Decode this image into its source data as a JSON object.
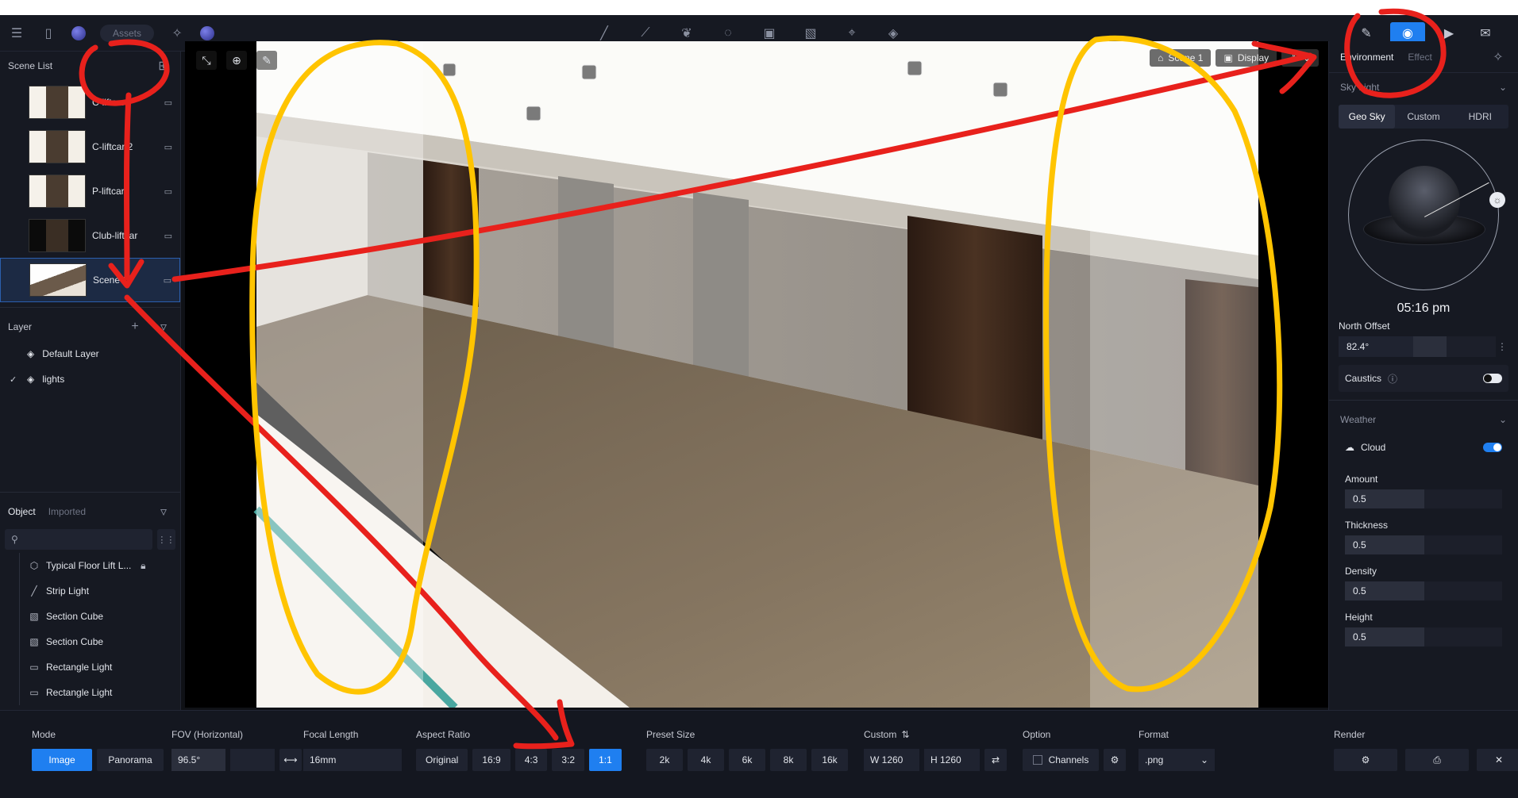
{
  "toolbar": {
    "assets_placeholder": "Assets"
  },
  "scene_list": {
    "title": "Scene List",
    "items": [
      {
        "label": "C-liftcar"
      },
      {
        "label": "C-liftcar 2"
      },
      {
        "label": "P-liftcar"
      },
      {
        "label": "Club-liftcar"
      },
      {
        "label": "Scene 1"
      }
    ]
  },
  "layer": {
    "title": "Layer",
    "items": [
      {
        "label": "Default Layer",
        "check": ""
      },
      {
        "label": "lights",
        "check": "✓"
      }
    ]
  },
  "object": {
    "tab_object": "Object",
    "tab_imported": "Imported",
    "search_value": "",
    "items": [
      {
        "label": "Typical Floor Lift L..."
      },
      {
        "label": "Strip Light"
      },
      {
        "label": "Section Cube"
      },
      {
        "label": "Section Cube"
      },
      {
        "label": "Rectangle Light"
      },
      {
        "label": "Rectangle Light"
      }
    ]
  },
  "viewport": {
    "scene_chip": "Scene 1",
    "display_chip": "Display"
  },
  "right": {
    "tab_environment": "Environment",
    "tab_effect": "Effect",
    "sky_light_title": "Sky Light",
    "sky_modes": [
      "Geo Sky",
      "Custom",
      "HDRI"
    ],
    "time": "05:16 pm",
    "north_offset_label": "North Offset",
    "north_offset_value": "82.4°",
    "caustics_label": "Caustics",
    "weather_title": "Weather",
    "cloud_label": "Cloud",
    "amount_label": "Amount",
    "amount_value": "0.5",
    "thickness_label": "Thickness",
    "thickness_value": "0.5",
    "density_label": "Density",
    "density_value": "0.5",
    "height_label": "Height",
    "height_value": "0.5"
  },
  "bottom": {
    "mode_label": "Mode",
    "mode_image": "Image",
    "mode_panorama": "Panorama",
    "fov_label": "FOV (Horizontal)",
    "fov_value": "96.5°",
    "focal_label": "Focal Length",
    "focal_value": "16mm",
    "aspect_label": "Aspect Ratio",
    "aspect_options": [
      "Original",
      "16:9",
      "4:3",
      "3:2",
      "1:1"
    ],
    "preset_label": "Preset Size",
    "preset_options": [
      "2k",
      "4k",
      "6k",
      "8k",
      "16k"
    ],
    "custom_label": "Custom",
    "custom_w": "W  1260",
    "custom_h": "H  1260",
    "option_label": "Option",
    "channels_label": "Channels",
    "format_label": "Format",
    "format_value": ".png",
    "render_label": "Render"
  },
  "colors": {
    "accent": "#1f7ff0",
    "annotation_red": "#e8211c",
    "annotation_yellow": "#ffc400"
  }
}
